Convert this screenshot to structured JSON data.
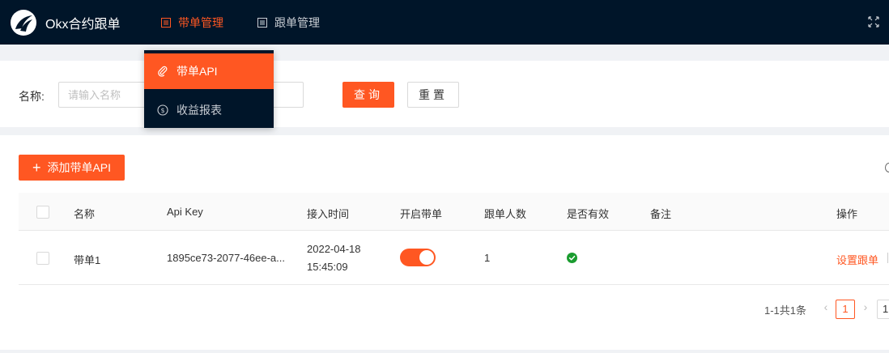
{
  "header": {
    "app_title": "Okx合约跟单",
    "nav": [
      {
        "label": "带单管理",
        "icon": "list-icon",
        "active": true
      },
      {
        "label": "跟单管理",
        "icon": "list-icon",
        "active": false
      }
    ],
    "fullscreen_icon": "fullscreen-icon"
  },
  "dropdown": {
    "items": [
      {
        "label": "带单API",
        "icon": "paperclip-icon",
        "selected": true
      },
      {
        "label": "收益报表",
        "icon": "dollar-circle-icon",
        "selected": false
      }
    ]
  },
  "search": {
    "name_label": "名称:",
    "name_placeholder": "请输入名称",
    "query_label": "查询",
    "reset_label": "重置"
  },
  "table": {
    "add_button_label": "添加带单API",
    "columns": [
      "名称",
      "Api Key",
      "接入时间",
      "开启带单",
      "跟单人数",
      "是否有效",
      "备注",
      "操作"
    ],
    "rows": [
      {
        "name": "带单1",
        "api_key": "1895ce73-2077-46ee-a...",
        "access_date": "2022-04-18",
        "access_time": "15:45:09",
        "enabled": true,
        "follower_count": "1",
        "valid": true,
        "remark": "",
        "action": "设置跟单"
      }
    ]
  },
  "pagination": {
    "total_text": "1-1共1条",
    "current_page": "1",
    "page_size_partial": "1"
  },
  "colors": {
    "accent": "#ff5722",
    "header_bg": "#001529",
    "valid_green": "#1a9c2f"
  }
}
